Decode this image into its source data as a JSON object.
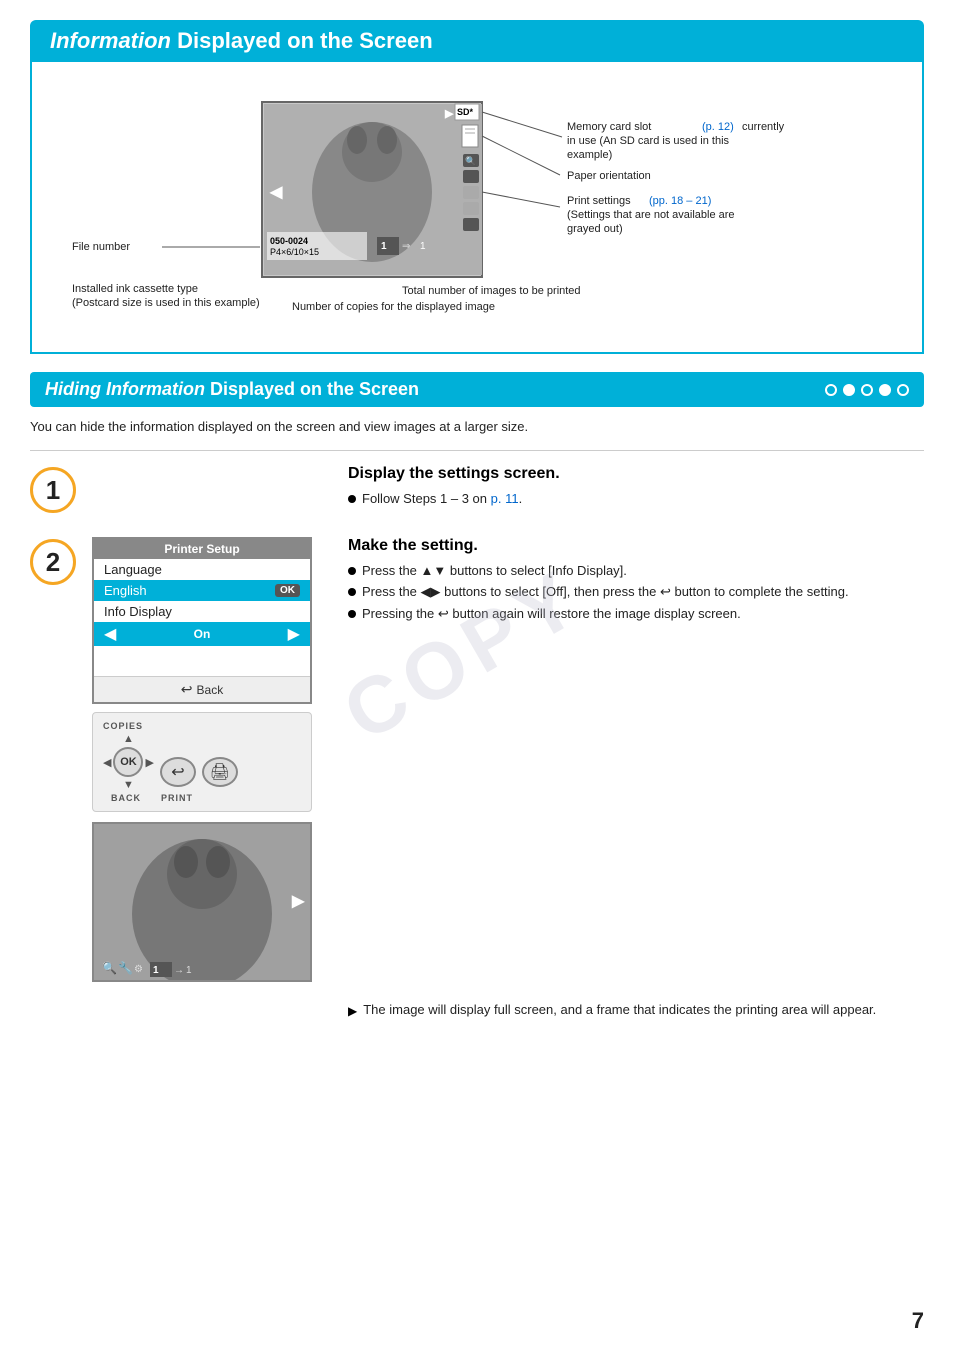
{
  "page": {
    "number": "7"
  },
  "header": {
    "title_bold": "Information",
    "title_rest": " Displayed on the Screen"
  },
  "diagram": {
    "annotations": {
      "memory_card": "Memory card slot (p. 12) currently\nin use (An SD card is used in this\nexample)",
      "paper_orientation": "Paper orientation",
      "print_settings": "Print settings (pp. 18 – 21)\n(Settings that are not available are\ngrayed out)",
      "file_number": "File number",
      "installed_ink": "Installed ink cassette type\n(Postcard size is used in this example)",
      "total_images": "Total number of images to be printed",
      "copies_displayed": "Number of copies for the displayed image"
    },
    "sd_label": "SD*",
    "file_number_value": "050-0024",
    "paper_size": "P4×6/10×15",
    "copies_count": "1"
  },
  "section2": {
    "title_bold": "Hiding Information",
    "title_rest": " Displayed on the Screen",
    "description": "You can hide the information displayed on the screen and view images at a larger size.",
    "dots": [
      "empty",
      "filled",
      "empty",
      "filled",
      "empty"
    ]
  },
  "step1": {
    "number": "1",
    "title": "Display the settings screen.",
    "bullets": [
      "Follow Steps 1 – 3 on p. 11."
    ]
  },
  "step2": {
    "number": "2",
    "title": "Make the setting.",
    "bullets": [
      "Press the ▲▼ buttons to select [Info Display].",
      "Press the ◀▶ buttons to select [Off], then press the ↩ button to complete the setting.",
      "Pressing the ↩ button again will restore the image display screen."
    ],
    "printer_setup_screen": {
      "title": "Printer Setup",
      "row1_label": "Language",
      "row1_value": "English",
      "row2_label": "Info Display",
      "row2_value": "On",
      "ok_btn": "OK",
      "back_label": "Back"
    },
    "controls": {
      "copies_label": "COPIES",
      "back_label": "BACK",
      "print_label": "PRINT",
      "ok_label": "OK"
    },
    "result_text": "The image will display full screen, and a frame that indicates the printing area will appear."
  },
  "watermark": "COPY"
}
